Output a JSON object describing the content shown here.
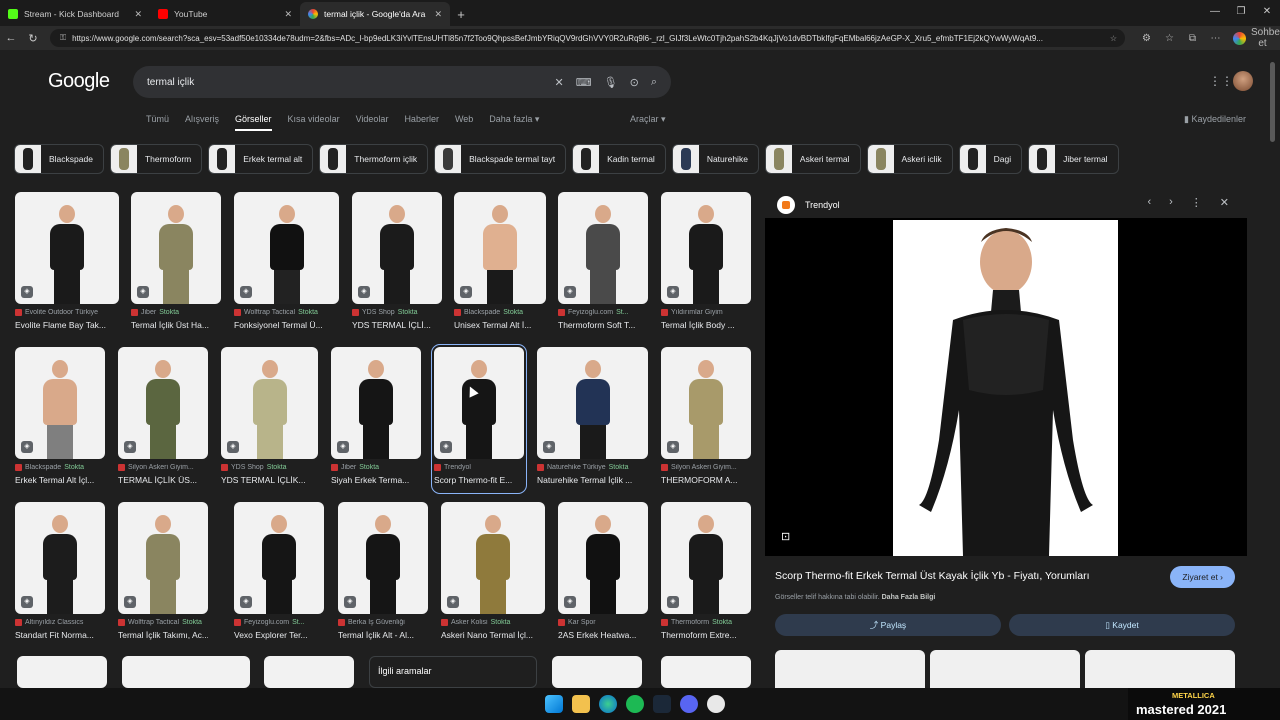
{
  "browser": {
    "tabs": [
      {
        "title": "Stream - Kick Dashboard",
        "color": "#53fc18"
      },
      {
        "title": "YouTube",
        "color": "#ff0000"
      },
      {
        "title": "termal içlik - Google'da Ara",
        "color": "#ffffff"
      }
    ],
    "url": "https://www.google.com/search?sca_esv=53adf50e10334de78udm=2&fbs=ADc_l-bp9edLK3iYvlTEnsUHTl85n7f2Too9QhpssBefJmbYRiqQV9rdGhVVY0R2uRq9l6-_rzl_GIJf3LeWtc0Tjh2pahS2b4KqJjVo1dvBDTbkIfgFqEMbal66jzAeGP-X_Xru5_efmbTF1Ej2kQYwWyWqAt9...",
    "chat_label": "Sohbet et"
  },
  "google": {
    "logo": "Google",
    "query": "termal içlik",
    "nav_tabs": [
      "Tümü",
      "Alışveriş",
      "Görseller",
      "Kısa videolar",
      "Videolar",
      "Haberler",
      "Web",
      "Daha fazla ▾"
    ],
    "tools": "Araçlar ▾",
    "saved": "Kaydedilenler",
    "chips": [
      "Blackspade",
      "Thermoform",
      "Erkek termal alt",
      "Thermoform içlik",
      "Blackspade termal tayt",
      "Kadin termal",
      "Naturehike",
      "Askeri termal",
      "Askeri iclik",
      "Dagi",
      "Jiber termal"
    ],
    "results": [
      {
        "src": "Evolite Outdoor Türkiye",
        "stock": "",
        "title": "Evolite Flame Bay Tak..."
      },
      {
        "src": "Jiber",
        "stock": "Stokta",
        "title": "Termal İçlik Üst Ha..."
      },
      {
        "src": "Wolftrap Tactical",
        "stock": "Stokta",
        "title": "Fonksiyonel Termal Ü..."
      },
      {
        "src": "YDS Shop",
        "stock": "Stokta",
        "title": "YDS TERMAL İÇLİ..."
      },
      {
        "src": "Blackspade",
        "stock": "Stokta",
        "title": "Unisex Termal Alt İ..."
      },
      {
        "src": "Feyizoglu.com",
        "stock": "St...",
        "title": "Thermoform Soft T..."
      },
      {
        "src": "Yıldırımlar Giyim",
        "stock": "",
        "title": "Termal İçlik Body ..."
      },
      {
        "src": "Blackspade",
        "stock": "Stokta",
        "title": "Erkek Termal Alt İçl..."
      },
      {
        "src": "Silyon Askeri Giyim...",
        "stock": "",
        "title": "TERMAL İÇLİK ÜS..."
      },
      {
        "src": "YDS Shop",
        "stock": "Stokta",
        "title": "YDS TERMAL İÇLİK..."
      },
      {
        "src": "Jiber",
        "stock": "Stokta",
        "title": "Siyah Erkek Terma..."
      },
      {
        "src": "Trendyol",
        "stock": "",
        "title": "Scorp Thermo-fit E..."
      },
      {
        "src": "Naturehike Türkiye",
        "stock": "Stokta",
        "title": "Naturehike Termal İçlik ..."
      },
      {
        "src": "Silyon Askeri Giyim...",
        "stock": "",
        "title": "THERMOFORM A..."
      },
      {
        "src": "Altınyıldız Classics",
        "stock": "",
        "title": "Standart Fit Norma..."
      },
      {
        "src": "Wolftrap Tactical",
        "stock": "Stokta",
        "title": "Termal İçlik Takımı, Ac..."
      },
      {
        "src": "Feyizoglu.com",
        "stock": "St...",
        "title": "Vexo Explorer Ter..."
      },
      {
        "src": "Berka İş Güvenliği",
        "stock": "",
        "title": "Termal İçlik Alt - Al..."
      },
      {
        "src": "Asker Kolisi",
        "stock": "Stokta",
        "title": "Askeri Nano Termal İçl..."
      },
      {
        "src": "Kar Spor",
        "stock": "",
        "title": "2AS Erkek Heatwa..."
      },
      {
        "src": "Thermoform",
        "stock": "Stokta",
        "title": "Thermoform Extre..."
      }
    ],
    "related_label": "İlgili aramalar"
  },
  "panel": {
    "site": "Trendyol",
    "title": "Scorp Thermo-fit Erkek Termal Üst Kayak İçlik Yb - Fiyatı, Yorumları",
    "visit": "Ziyaret et ›",
    "note": "Görseller telif hakkına tabi olabilir.",
    "note_link": "Daha Fazla Bilgi",
    "share": "Paylaş",
    "save": "Kaydet"
  },
  "taskbar": {
    "now_playing_artist": "METALLICA",
    "now_playing_title": "mastered 2021"
  }
}
